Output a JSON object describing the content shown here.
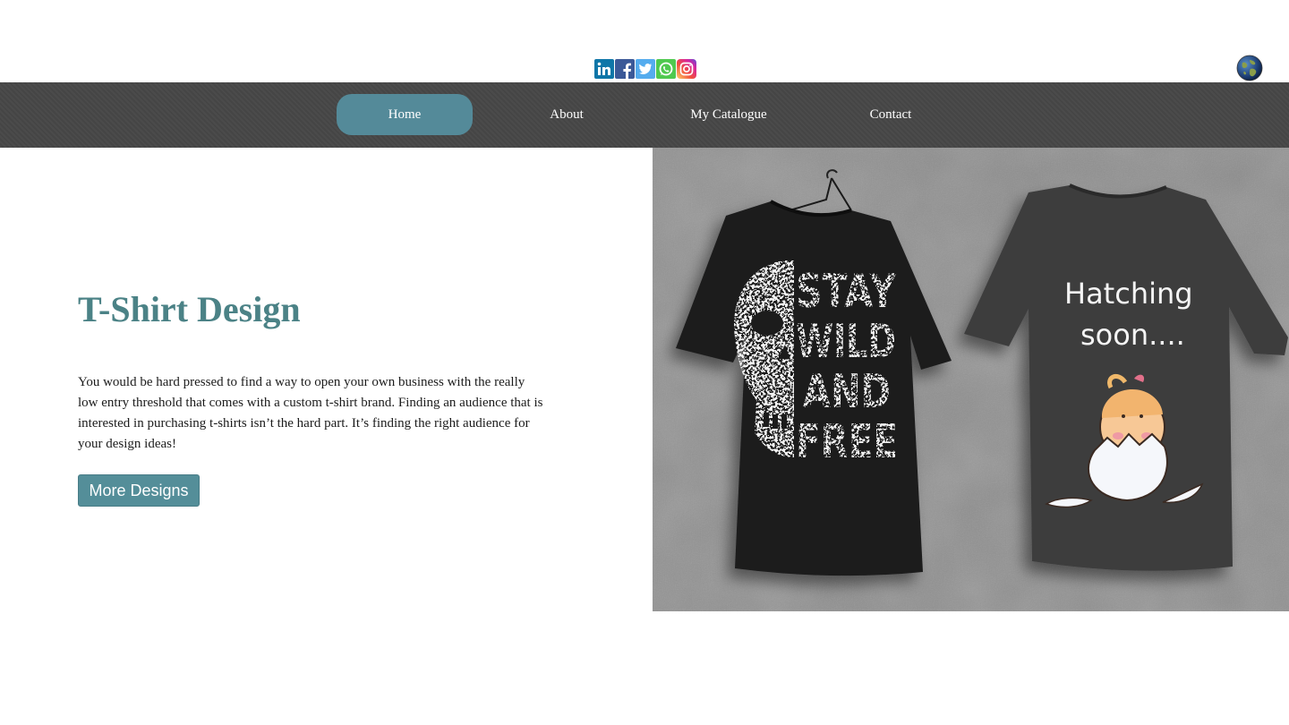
{
  "social": {
    "icons": [
      {
        "name": "linkedin-icon",
        "glyph": "in",
        "color": "#0e76a8"
      },
      {
        "name": "facebook-icon",
        "glyph": "f",
        "color": "#3b5998"
      },
      {
        "name": "twitter-icon",
        "glyph": "t",
        "color": "#55acee"
      },
      {
        "name": "whatsapp-icon",
        "glyph": "w",
        "color": "#4fc94f"
      },
      {
        "name": "instagram-icon",
        "glyph": "ig",
        "color": "#d6249f"
      }
    ],
    "globe_icon": "globe-icon"
  },
  "nav": {
    "items": [
      {
        "label": "Home",
        "active": true
      },
      {
        "label": "About",
        "active": false
      },
      {
        "label": "My Catalogue",
        "active": false
      },
      {
        "label": "Contact",
        "active": false
      }
    ],
    "bg_color": "#474747",
    "active_color": "#548a99"
  },
  "hero": {
    "title": "T-Shirt Design",
    "body": "You would be hard pressed to find a way to open your own business with the really low entry threshold that comes with a custom t-shirt brand. Finding an audience that is interested in purchasing t-shirts isn’t the hard part. It’s finding the right audience for your design ideas!",
    "button_label": "More Designs",
    "title_color": "#4b8286",
    "button_color": "#548e99"
  },
  "image": {
    "shirt_left_text": [
      "STAY",
      "WILD",
      "AND",
      "FREE"
    ],
    "shirt_right_text": [
      "Hatching",
      "soon...."
    ]
  }
}
